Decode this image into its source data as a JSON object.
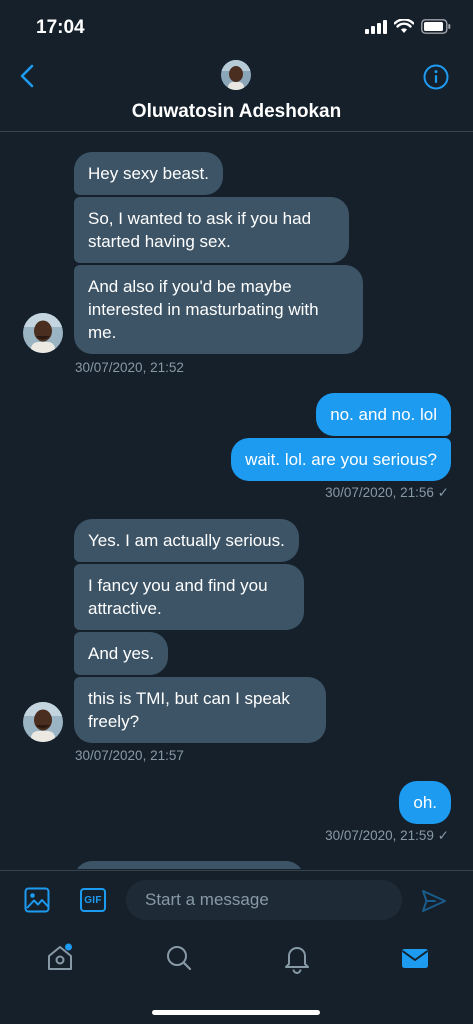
{
  "status_bar": {
    "time": "17:04"
  },
  "header": {
    "contact_name": "Oluwatosin Adeshokan"
  },
  "messages": {
    "g1": {
      "m1": "Hey sexy beast.",
      "m2": "So, I wanted to ask if you had started having sex.",
      "m3": "And also if you'd be maybe interested in masturbating with me.",
      "timestamp": "30/07/2020, 21:52"
    },
    "g2": {
      "m1": "no. and no. lol",
      "m2": "wait. lol. are you serious?",
      "timestamp": "30/07/2020, 21:56 ✓"
    },
    "g3": {
      "m1": "Yes. I am actually serious.",
      "m2": "I fancy you and find you attractive.",
      "m3": "And yes.",
      "m4": "this is TMI, but can I speak freely?",
      "timestamp": "30/07/2020, 21:57"
    },
    "g4": {
      "m1": "oh.",
      "timestamp": "30/07/2020, 21:59 ✓"
    }
  },
  "composer": {
    "gif_label": "GIF",
    "placeholder": "Start a message",
    "image_icon": "image-icon",
    "send_icon": "send-icon"
  },
  "tab_bar": {
    "icons": [
      "home-icon",
      "search-icon",
      "notifications-icon",
      "messages-icon"
    ],
    "active": "messages-icon"
  },
  "colors": {
    "background": "#15202b",
    "accent": "#1d9bf0",
    "received_bubble": "#3d5466",
    "muted_text": "#8899a6"
  }
}
